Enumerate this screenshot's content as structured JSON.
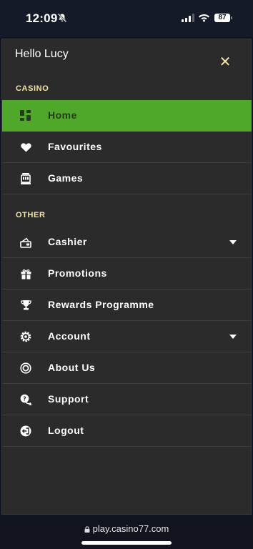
{
  "status_bar": {
    "time": "12:09",
    "battery": "87"
  },
  "menu": {
    "greeting": "Hello Lucy",
    "close_symbol": "✕",
    "sections": [
      {
        "title": "CASINO"
      },
      {
        "title": "OTHER"
      }
    ],
    "items": [
      {
        "label": "Home",
        "icon": "dashboard-icon",
        "active": true
      },
      {
        "label": "Favourites",
        "icon": "heart-icon"
      },
      {
        "label": "Games",
        "icon": "slot-machine-icon"
      },
      {
        "label": "Cashier",
        "icon": "wallet-icon",
        "expandable": true
      },
      {
        "label": "Promotions",
        "icon": "gift-icon"
      },
      {
        "label": "Rewards Programme",
        "icon": "trophy-icon"
      },
      {
        "label": "Account",
        "icon": "gear-icon",
        "expandable": true
      },
      {
        "label": "About Us",
        "icon": "info-circle-icon"
      },
      {
        "label": "Support",
        "icon": "chat-icon"
      },
      {
        "label": "Logout",
        "icon": "logout-icon"
      }
    ]
  },
  "browser": {
    "url": "play.casino77.com"
  },
  "colors": {
    "accent": "#4fa82a",
    "section_title": "#f1e7a8",
    "menu_bg": "#2b2b2b"
  }
}
